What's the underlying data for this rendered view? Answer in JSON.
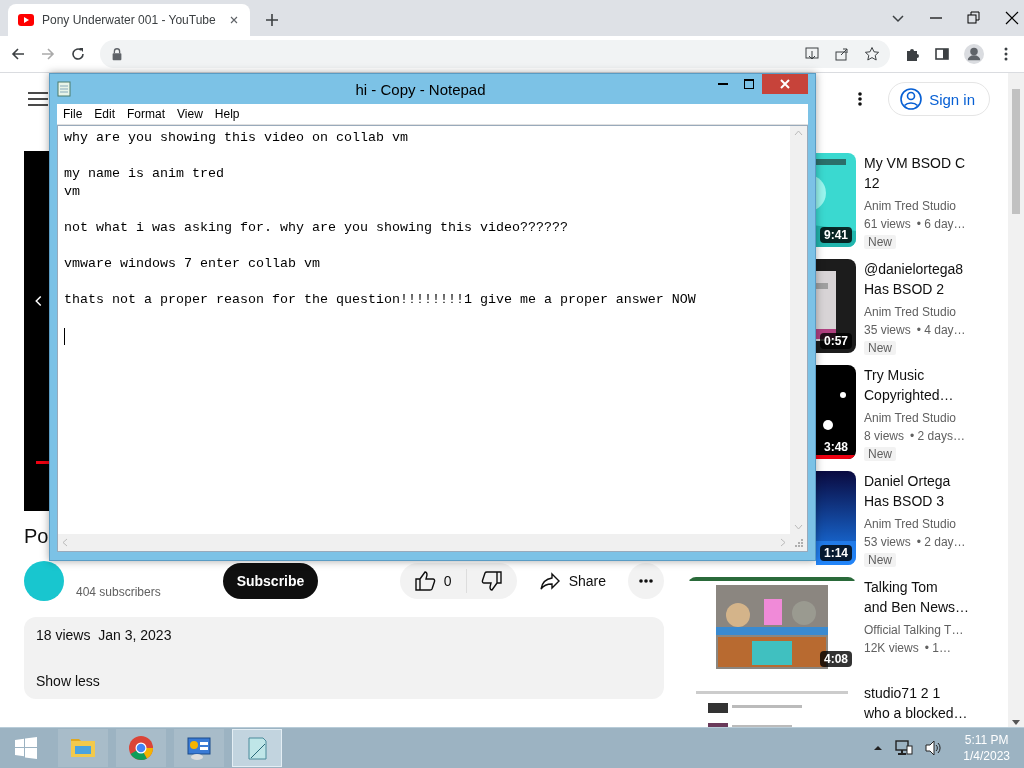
{
  "browser": {
    "tabs": [
      {
        "title": "Pony Underwater 001 - YouTube",
        "selected": true
      }
    ]
  },
  "youtube": {
    "sign_in": "Sign in",
    "video": {
      "title": "Po",
      "subscribers": "404 subscribers",
      "subscribe": "Subscribe",
      "likes": "0",
      "share": "Share",
      "description": {
        "stats": "18 views  Jan 3, 2023",
        "toggle": "Show less"
      }
    },
    "related": [
      {
        "title": "My VM BSOD C\n12",
        "channel": "Anim Tred Studio",
        "views": "61 views",
        "age": "• 6 day…",
        "duration": "9:41",
        "badge": "New"
      },
      {
        "title": "@danielortega8\nHas BSOD 2",
        "channel": "Anim Tred Studio",
        "views": "35 views",
        "age": "• 4 day…",
        "duration": "0:57",
        "badge": "New"
      },
      {
        "title": "Try Music\nCopyrighted…",
        "channel": "Anim Tred Studio",
        "views": "8 views",
        "age": "• 2 days…",
        "duration": "3:48",
        "badge": "New"
      },
      {
        "title": "Daniel Ortega\nHas BSOD 3",
        "channel": "Anim Tred Studio",
        "views": "53 views",
        "age": "• 2 day…",
        "duration": "1:14",
        "badge": "New"
      },
      {
        "title": "Talking Tom\nand Ben News…",
        "channel": "Official Talking T…",
        "views": "12K views",
        "age": "• 1…",
        "duration": "4:08"
      },
      {
        "title": "studio71 2 1\nwho a blocked…"
      }
    ]
  },
  "notepad": {
    "title": "hi - Copy - Notepad",
    "menu": [
      "File",
      "Edit",
      "Format",
      "View",
      "Help"
    ],
    "text": "why are you showing this video on collab vm\n\nmy name is anim tred\nvm\n\nnot what i was asking for. why are you showing this video??????\n\nvmware windows 7 enter collab vm\n\nthats not a proper reason for the question!!!!!!!!1 give me a proper answer NOW"
  },
  "taskbar": {
    "apps": [
      {
        "kind": "explorer",
        "active": false
      },
      {
        "kind": "chrome",
        "active": false
      },
      {
        "kind": "control-panel",
        "active": false
      },
      {
        "kind": "notepad",
        "active": true
      }
    ],
    "clock": {
      "time": "5:11 PM",
      "date": "1/4/2023"
    }
  }
}
